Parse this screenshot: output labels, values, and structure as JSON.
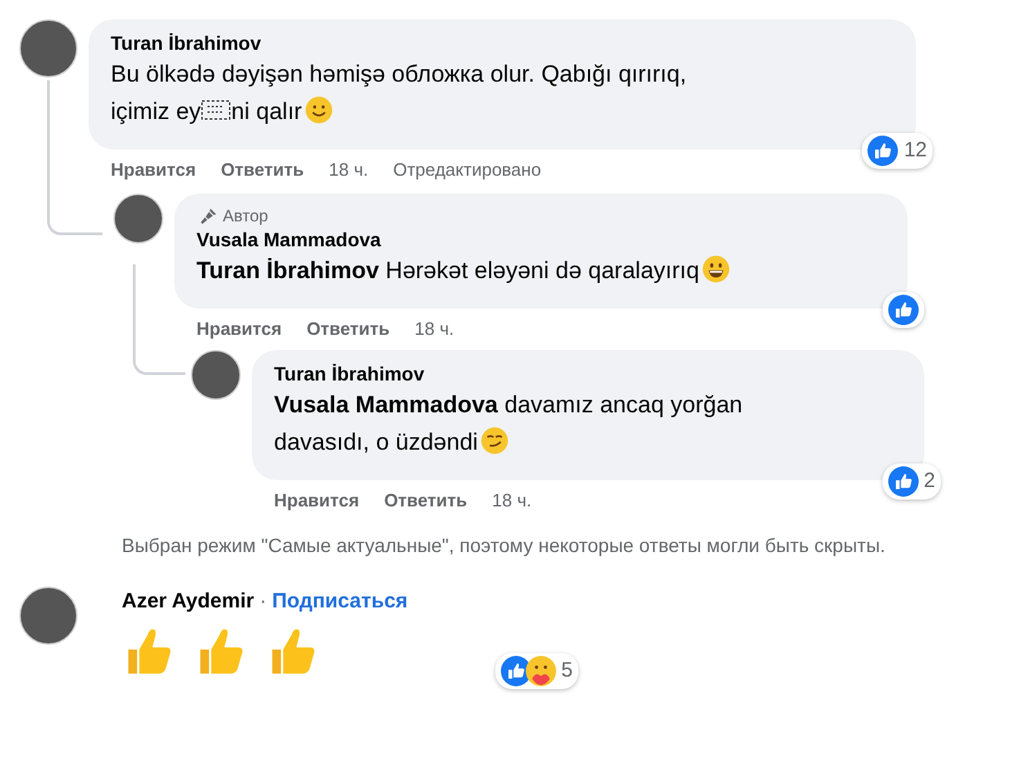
{
  "comments": [
    {
      "author": "Turan İbrahimov",
      "segments": [
        {
          "kind": "line",
          "text": "Bu ölkədə dəyişən həmişə обложка olur. Qabığı qırırıq,"
        },
        {
          "kind": "text",
          "text": "içimiz ey"
        },
        {
          "kind": "obscured"
        },
        {
          "kind": "text",
          "text": "ni qalır"
        },
        {
          "kind": "smile"
        }
      ],
      "actions": {
        "like": "Нравится",
        "reply": "Ответить",
        "time": "18 ч.",
        "edited": "Отредактировано"
      },
      "reactions": {
        "icons": [
          {
            "kind": "like"
          }
        ],
        "count": "12"
      },
      "replies": [
        {
          "author": "Vusala Mammadova",
          "badge": "Автор",
          "segments": [
            {
              "kind": "text",
              "text": "**Turan İbrahimov** Hərəkət eləyəni də qaralayırıq"
            },
            {
              "kind": "grin"
            }
          ],
          "actions": {
            "like": "Нравится",
            "reply": "Ответить",
            "time": "18 ч."
          },
          "reactions": {
            "icons": [
              {
                "kind": "like"
              }
            ]
          },
          "replies": [
            {
              "author": "Turan İbrahimov",
              "segments": [
                {
                  "kind": "line",
                  "text": "**Vusala Mammadova** davamız ancaq yorğan"
                },
                {
                  "kind": "text",
                  "text": "davasıdı, o üzdəndi"
                },
                {
                  "kind": "smirk"
                }
              ],
              "actions": {
                "like": "Нравится",
                "reply": "Ответить",
                "time": "18 ч."
              },
              "reactions": {
                "icons": [
                  {
                    "kind": "like"
                  }
                ],
                "count": "2"
              }
            }
          ]
        }
      ]
    }
  ],
  "mode_note": "Выбран режим \"Самые актуальные\", поэтому некоторые ответы могли быть скрыты.",
  "next_comment": {
    "author": "Azer Aydemir",
    "separator": "·",
    "follow": "Подписаться",
    "emojis": [
      {
        "kind": "thumbs"
      },
      {
        "kind": "thumbs"
      },
      {
        "kind": "thumbs"
      }
    ],
    "reactions": {
      "icons": [
        {
          "kind": "like"
        },
        {
          "kind": "care"
        }
      ],
      "count": "5"
    }
  }
}
